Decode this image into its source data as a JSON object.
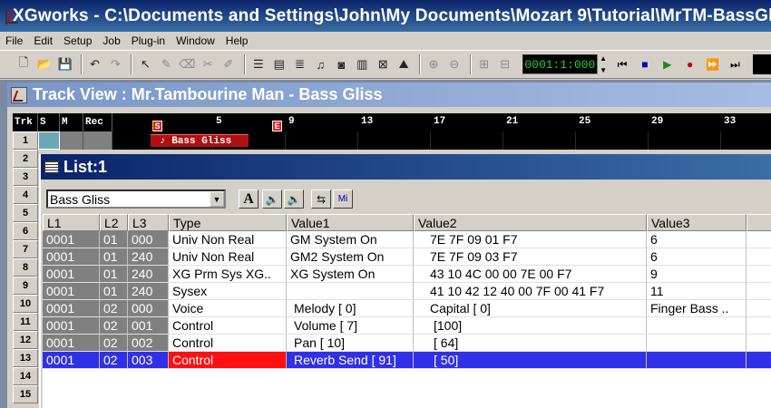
{
  "window": {
    "title": "XGworks - C:\\Documents and Settings\\John\\My Documents\\Mozart 9\\Tutorial\\MrTM-BassGliss"
  },
  "menu": [
    "File",
    "Edit",
    "Setup",
    "Job",
    "Plug-in",
    "Window",
    "Help"
  ],
  "toolbar": {
    "counter": "0001:1:000"
  },
  "track_view": {
    "title": "Track View : Mr.Tambourine Man - Bass Gliss",
    "headers": {
      "trk": "Trk",
      "s": "S",
      "m": "M",
      "rec": "Rec"
    },
    "ruler": [
      "5",
      "9",
      "13",
      "17",
      "21",
      "25",
      "29",
      "33"
    ],
    "start_marker": "S",
    "end_marker": "E",
    "rows": [
      "1",
      "2",
      "3",
      "4",
      "5",
      "6",
      "7",
      "8",
      "9",
      "10",
      "11",
      "12",
      "13",
      "14",
      "15"
    ],
    "clip_label": "Bass Gliss"
  },
  "list_window": {
    "title": "List:1",
    "combo_value": "Bass Gliss",
    "columns": [
      "L1",
      "L2",
      "L3",
      "Type",
      "Value1",
      "Value2",
      "Value3"
    ],
    "rows": [
      {
        "l1": "0001",
        "l2": "01",
        "l3": "000",
        "type": "Univ Non Real",
        "v1": "GM System On",
        "v2": "7E 7F 09 01 F7",
        "v3": "6"
      },
      {
        "l1": "0001",
        "l2": "01",
        "l3": "240",
        "type": "Univ Non Real",
        "v1": "GM2 System On",
        "v2": "7E 7F 09 03 F7",
        "v3": "6"
      },
      {
        "l1": "0001",
        "l2": "01",
        "l3": "240",
        "type": "XG Prm Sys XG..",
        "v1": "XG System On",
        "v2": "43 10 4C 00 00 7E 00 F7",
        "v3": "9"
      },
      {
        "l1": "0001",
        "l2": "01",
        "l3": "240",
        "type": "Sysex",
        "v1": "",
        "v2": "41 10 42 12 40 00 7F 00 41 F7",
        "v3": "11"
      },
      {
        "l1": "0001",
        "l2": "02",
        "l3": "000",
        "type": "Voice",
        "v1": "Melody [  0]",
        "v2": "Capital [  0]",
        "v3": "Finger Bass .."
      },
      {
        "l1": "0001",
        "l2": "02",
        "l3": "001",
        "type": "Control",
        "v1": "Volume [  7]",
        "v2": "[100]",
        "v3": ""
      },
      {
        "l1": "0001",
        "l2": "02",
        "l3": "002",
        "type": "Control",
        "v1": "Pan [ 10]",
        "v2": "[ 64]",
        "v3": ""
      },
      {
        "l1": "0001",
        "l2": "02",
        "l3": "003",
        "type": "Control",
        "v1": "Reverb Send [ 91]",
        "v2": "[ 50]",
        "v3": ""
      }
    ],
    "selected_row": 7
  },
  "colors": {
    "selected_row": "#3030e8",
    "selected_type": "#ff1010",
    "counter_text": "#2bd02b"
  }
}
